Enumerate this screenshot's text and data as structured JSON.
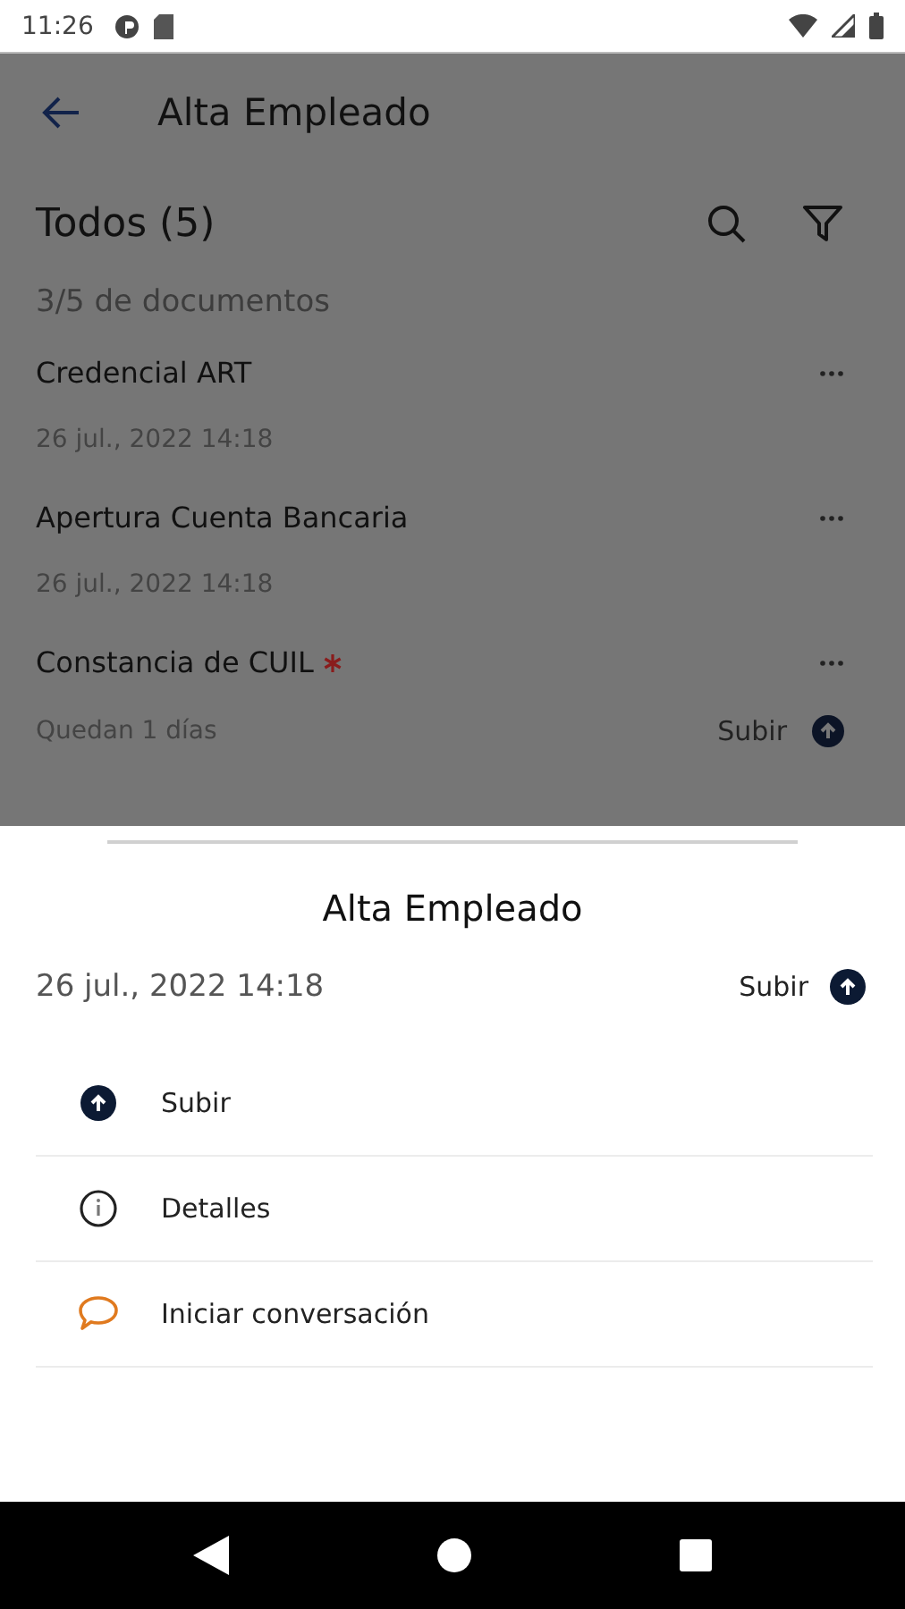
{
  "status_bar": {
    "time": "11:26"
  },
  "header": {
    "title": "Alta Empleado"
  },
  "list_header": {
    "title": "Todos (5)",
    "progress": "3/5 de documentos"
  },
  "documents": [
    {
      "name": "Credencial ART",
      "required": false,
      "kind": "date",
      "meta": "26 jul., 2022 14:18"
    },
    {
      "name": "Apertura Cuenta Bancaria",
      "required": false,
      "kind": "date",
      "meta": "26 jul., 2022 14:18"
    },
    {
      "name": "Constancia de CUIL",
      "required": true,
      "kind": "remaining",
      "meta": "Quedan 1 días",
      "action": "Subir"
    }
  ],
  "sheet": {
    "title": "Alta Empleado",
    "date": "26 jul., 2022 14:18",
    "action": "Subir",
    "items": [
      {
        "kind": "upload",
        "label": "Subir"
      },
      {
        "kind": "info",
        "label": "Detalles"
      },
      {
        "kind": "chat",
        "label": "Iniciar conversación"
      }
    ]
  }
}
